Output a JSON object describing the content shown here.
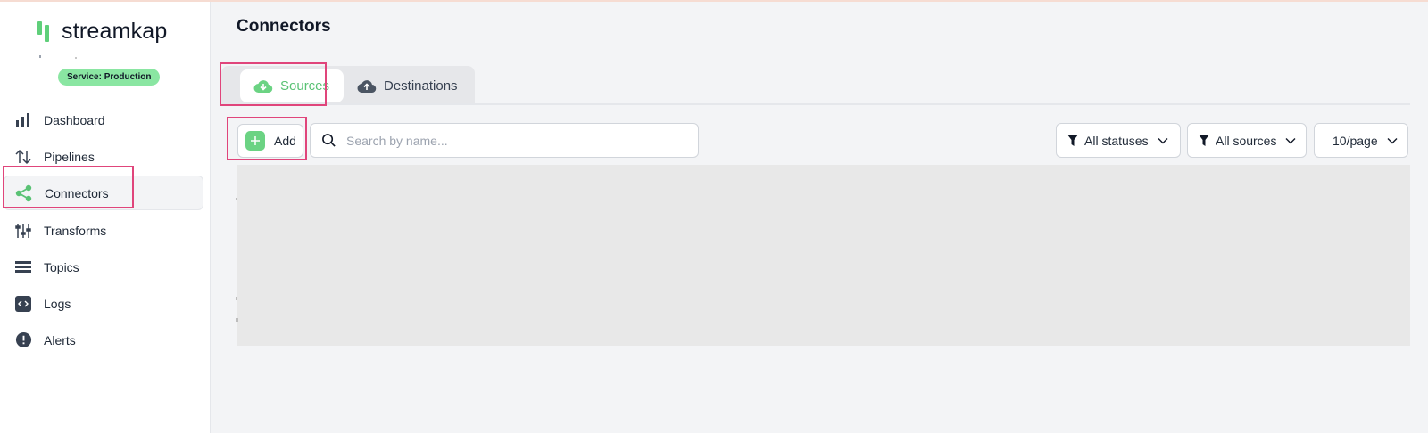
{
  "app": {
    "brand": "streamkap",
    "service_badge": "Service: Production"
  },
  "sidebar": {
    "items": [
      {
        "label": "Dashboard",
        "icon": "bar-chart-icon"
      },
      {
        "label": "Pipelines",
        "icon": "arrows-up-down-icon"
      },
      {
        "label": "Connectors",
        "icon": "share-icon",
        "active": true
      },
      {
        "label": "Transforms",
        "icon": "sliders-icon"
      },
      {
        "label": "Topics",
        "icon": "stack-icon"
      },
      {
        "label": "Logs",
        "icon": "code-icon"
      },
      {
        "label": "Alerts",
        "icon": "alert-circle-icon"
      }
    ]
  },
  "main": {
    "title": "Connectors",
    "tabs": [
      {
        "label": "Sources",
        "icon": "cloud-download-icon",
        "active": true
      },
      {
        "label": "Destinations",
        "icon": "cloud-upload-icon",
        "active": false
      }
    ],
    "toolbar": {
      "add_label": "Add",
      "search_placeholder": "Search by name...",
      "status_filter": "All statuses",
      "source_filter": "All sources",
      "page_size": "10/page"
    }
  },
  "colors": {
    "accent": "#5ac275",
    "highlight": "#e0457b",
    "badge": "#8ae6a2"
  }
}
